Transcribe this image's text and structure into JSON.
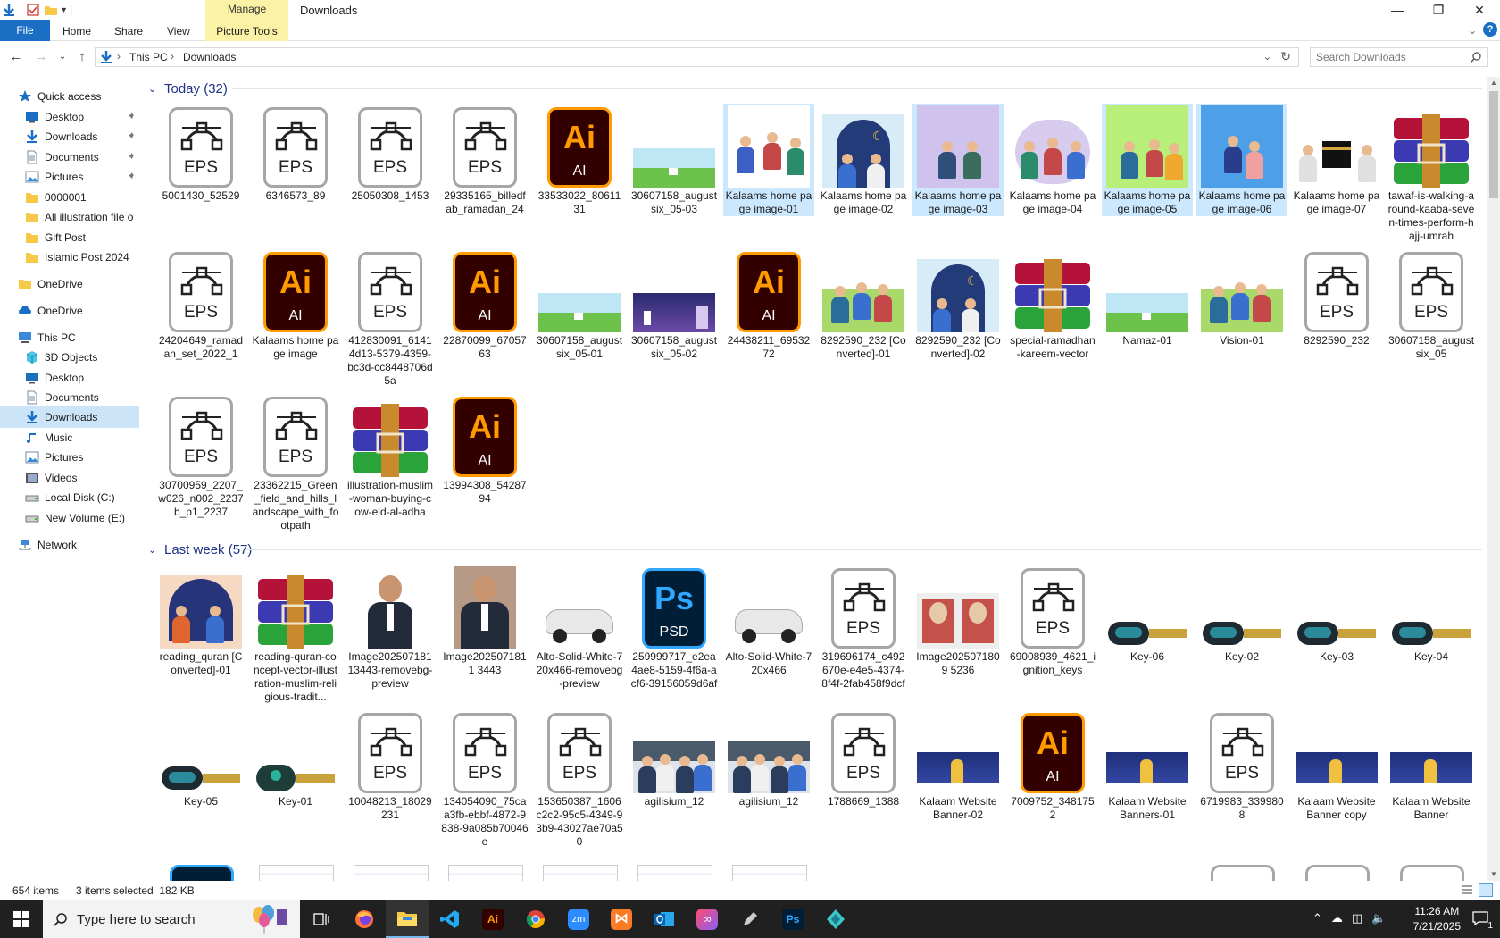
{
  "window": {
    "title": "Downloads",
    "manage_label": "Manage",
    "picture_tools_label": "Picture Tools",
    "file_label": "File",
    "tabs": [
      "Home",
      "Share",
      "View"
    ]
  },
  "address": {
    "crumbs": [
      "This PC",
      "Downloads"
    ],
    "search_placeholder": "Search Downloads"
  },
  "nav": {
    "items": [
      {
        "label": "Quick access",
        "icon": "star-icon"
      },
      {
        "label": "Desktop",
        "icon": "desktop-icon",
        "pinned": true
      },
      {
        "label": "Downloads",
        "icon": "download-icon",
        "pinned": true
      },
      {
        "label": "Documents",
        "icon": "documents-icon",
        "pinned": true
      },
      {
        "label": "Pictures",
        "icon": "pictures-icon",
        "pinned": true
      },
      {
        "label": "0000001",
        "icon": "folder-icon"
      },
      {
        "label": "All illustration file o",
        "icon": "folder-icon"
      },
      {
        "label": "Gift Post",
        "icon": "folder-icon"
      },
      {
        "label": "Islamic Post 2024",
        "icon": "folder-icon"
      },
      {
        "label": "OneDrive",
        "icon": "folder-icon"
      },
      {
        "label": "OneDrive",
        "icon": "cloud-icon"
      },
      {
        "label": "This PC",
        "icon": "pc-icon"
      },
      {
        "label": "3D Objects",
        "icon": "cube-icon"
      },
      {
        "label": "Desktop",
        "icon": "desktop-icon"
      },
      {
        "label": "Documents",
        "icon": "documents-icon"
      },
      {
        "label": "Downloads",
        "icon": "download-icon",
        "selected": true
      },
      {
        "label": "Music",
        "icon": "music-icon"
      },
      {
        "label": "Pictures",
        "icon": "pictures-icon"
      },
      {
        "label": "Videos",
        "icon": "videos-icon"
      },
      {
        "label": "Local Disk (C:)",
        "icon": "drive-icon"
      },
      {
        "label": "New Volume (E:)",
        "icon": "drive-icon"
      },
      {
        "label": "Network",
        "icon": "network-icon"
      }
    ]
  },
  "groups": [
    {
      "header": "Today (32)",
      "files": [
        {
          "name": "5001430_52529",
          "kind": "eps"
        },
        {
          "name": "6346573_89",
          "kind": "eps"
        },
        {
          "name": "25050308_1453",
          "kind": "eps"
        },
        {
          "name": "29335165_billedfab_ramadan_24",
          "kind": "eps"
        },
        {
          "name": "33533022_8061131",
          "kind": "ai"
        },
        {
          "name": "30607158_augustsix_05-03",
          "kind": "landscape"
        },
        {
          "name": "Kalaams home page image-01",
          "kind": "illus-white",
          "selected": true
        },
        {
          "name": "Kalaams home page image-02",
          "kind": "illus-night"
        },
        {
          "name": "Kalaams home page image-03",
          "kind": "illus-lilac",
          "selected": true
        },
        {
          "name": "Kalaams home page image-04",
          "kind": "illus-lilac2"
        },
        {
          "name": "Kalaams home page image-05",
          "kind": "illus-green",
          "selected": true
        },
        {
          "name": "Kalaams home page image-06",
          "kind": "illus-blue",
          "selected": true
        },
        {
          "name": "Kalaams home page image-07",
          "kind": "illus-kaaba"
        },
        {
          "name": "tawaf-is-walking-around-kaaba-seven-times-perform-hajj-umrah",
          "kind": "rar"
        },
        {
          "name": "24204649_ramadan_set_2022_1",
          "kind": "eps"
        },
        {
          "name": "Kalaams home page image",
          "kind": "ai"
        },
        {
          "name": "412830091_61414d13-5379-4359-bc3d-cc8448706d5a",
          "kind": "eps"
        },
        {
          "name": "22870099_6705763",
          "kind": "ai"
        },
        {
          "name": "30607158_augustsix_05-01",
          "kind": "landscape"
        },
        {
          "name": "30607158_augustsix_05-02",
          "kind": "landscape-night"
        },
        {
          "name": "24438211_6953272",
          "kind": "ai"
        },
        {
          "name": "8292590_232 [Converted]-01",
          "kind": "illus-family"
        },
        {
          "name": "8292590_232 [Converted]-02",
          "kind": "illus-night"
        },
        {
          "name": "special-ramadhan-kareem-vector",
          "kind": "rar"
        },
        {
          "name": "Namaz-01",
          "kind": "landscape"
        },
        {
          "name": "Vision-01",
          "kind": "illus-family"
        },
        {
          "name": "8292590_232",
          "kind": "eps"
        },
        {
          "name": "30607158_augustsix_05",
          "kind": "eps"
        },
        {
          "name": "30700959_2207_w026_n002_2237b_p1_2237",
          "kind": "eps"
        },
        {
          "name": "23362215_Green_field_and_hills_landscape_with_footpath",
          "kind": "eps"
        },
        {
          "name": "illustration-muslim-woman-buying-cow-eid-al-adha",
          "kind": "rar"
        },
        {
          "name": "13994308_5428794",
          "kind": "ai"
        }
      ]
    },
    {
      "header": "Last week (57)",
      "files": [
        {
          "name": "reading_quran [Converted]-01",
          "kind": "illus-quran"
        },
        {
          "name": "reading-quran-concept-vector-illustration-muslim-religious-tradit...",
          "kind": "rar"
        },
        {
          "name": "Image20250718113443-removebg-preview",
          "kind": "portrait-white"
        },
        {
          "name": "Image2025071811 3443",
          "kind": "portrait"
        },
        {
          "name": "Alto-Solid-White-720x466-removebg-preview",
          "kind": "car"
        },
        {
          "name": "259999717_e2ea4ae8-5159-4f6a-acf6-39156059d6af",
          "kind": "psd"
        },
        {
          "name": "Alto-Solid-White-720x466",
          "kind": "car"
        },
        {
          "name": "319696174_c492670e-e4e5-4374-8f4f-2fab458f9dcf",
          "kind": "eps"
        },
        {
          "name": "Image2025071809 5236",
          "kind": "collage"
        },
        {
          "name": "69008939_4621_ignition_keys",
          "kind": "eps"
        },
        {
          "name": "Key-06",
          "kind": "key"
        },
        {
          "name": "Key-02",
          "kind": "key"
        },
        {
          "name": "Key-03",
          "kind": "key"
        },
        {
          "name": "Key-04",
          "kind": "key"
        },
        {
          "name": "Key-05",
          "kind": "key"
        },
        {
          "name": "Key-01",
          "kind": "key-round"
        },
        {
          "name": "10048213_18029231",
          "kind": "eps"
        },
        {
          "name": "134054090_75caa3fb-ebbf-4872-9838-9a085b70046e",
          "kind": "eps"
        },
        {
          "name": "153650387_1606c2c2-95c5-4349-93b9-43027ae70a50",
          "kind": "eps"
        },
        {
          "name": "agilisium_12",
          "kind": "group-photo"
        },
        {
          "name": "agilisium_12",
          "kind": "group-photo"
        },
        {
          "name": "1788669_1388",
          "kind": "eps"
        },
        {
          "name": "Kalaam Website Banner-02",
          "kind": "banner"
        },
        {
          "name": "7009752_3481752",
          "kind": "ai"
        },
        {
          "name": "Kalaam Website Banners-01",
          "kind": "banner"
        },
        {
          "name": "6719983_3399808",
          "kind": "eps"
        },
        {
          "name": "Kalaam Website Banner copy",
          "kind": "banner"
        },
        {
          "name": "Kalaam Website Banner",
          "kind": "banner"
        }
      ]
    }
  ],
  "status": {
    "items": "654 items",
    "selected": "3 items selected  182 KB"
  },
  "taskbar": {
    "search_placeholder": "Type here to search",
    "time": "11:26 AM",
    "date": "7/21/2025",
    "notifications": "1"
  },
  "colors": {
    "accent": "#1a6fc4",
    "manage_tab": "#fbf2a6",
    "selection": "#cce8ff",
    "group_header": "#1e3287",
    "taskbar": "#202020"
  }
}
